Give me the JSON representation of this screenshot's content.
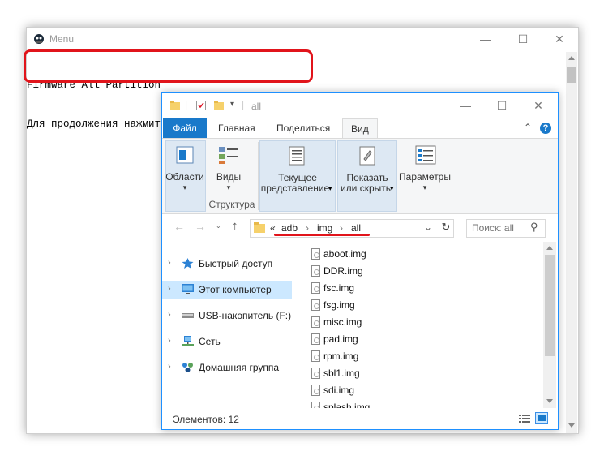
{
  "console": {
    "title": "Menu",
    "lines": [
      "Firmware All Partition",
      "Для продолжения нажмите любую клавишу . . ."
    ],
    "controls": {
      "minimize": "—",
      "maximize": "☐",
      "close": "✕"
    }
  },
  "explorer": {
    "title": "all",
    "controls": {
      "minimize": "—",
      "maximize": "☐",
      "close": "✕"
    },
    "tabs": [
      "Файл",
      "Главная",
      "Поделиться",
      "Вид"
    ],
    "ribbon_right": {
      "collapse": "⌃",
      "help": "?"
    },
    "ribbon": {
      "panes_label": "Области",
      "views_label": "Виды",
      "structure_label": "Структура",
      "current_view_label_1": "Текущее",
      "current_view_label_2": "представление",
      "show_hide_label_1": "Показать",
      "show_hide_label_2": "или скрыть",
      "options_label": "Параметры",
      "dropdown": "▾"
    },
    "address": {
      "back": "←",
      "forward": "→",
      "up": "↑",
      "prefix": "«",
      "segments": [
        "adb",
        "img",
        "all"
      ],
      "separator": "›",
      "dropdown": "⌄",
      "refresh": "↻",
      "search_placeholder": "Поиск: all",
      "search_icon": "⚲"
    },
    "nav": [
      {
        "label": "Быстрый доступ",
        "icon": "star-icon"
      },
      {
        "label": "Этот компьютер",
        "icon": "computer-icon"
      },
      {
        "label": "USB-накопитель (F:)",
        "icon": "usb-drive-icon"
      },
      {
        "label": "Сеть",
        "icon": "network-icon"
      },
      {
        "label": "Домашняя группа",
        "icon": "homegroup-icon"
      }
    ],
    "files": [
      "aboot.img",
      "DDR.img",
      "fsc.img",
      "fsg.img",
      "misc.img",
      "pad.img",
      "rpm.img",
      "sbl1.img",
      "sdi.img",
      "splash.img"
    ],
    "status": "Элементов: 12",
    "colors": {
      "accent": "#1979ca",
      "highlight": "#e1141b",
      "selected": "#cce8ff"
    }
  }
}
